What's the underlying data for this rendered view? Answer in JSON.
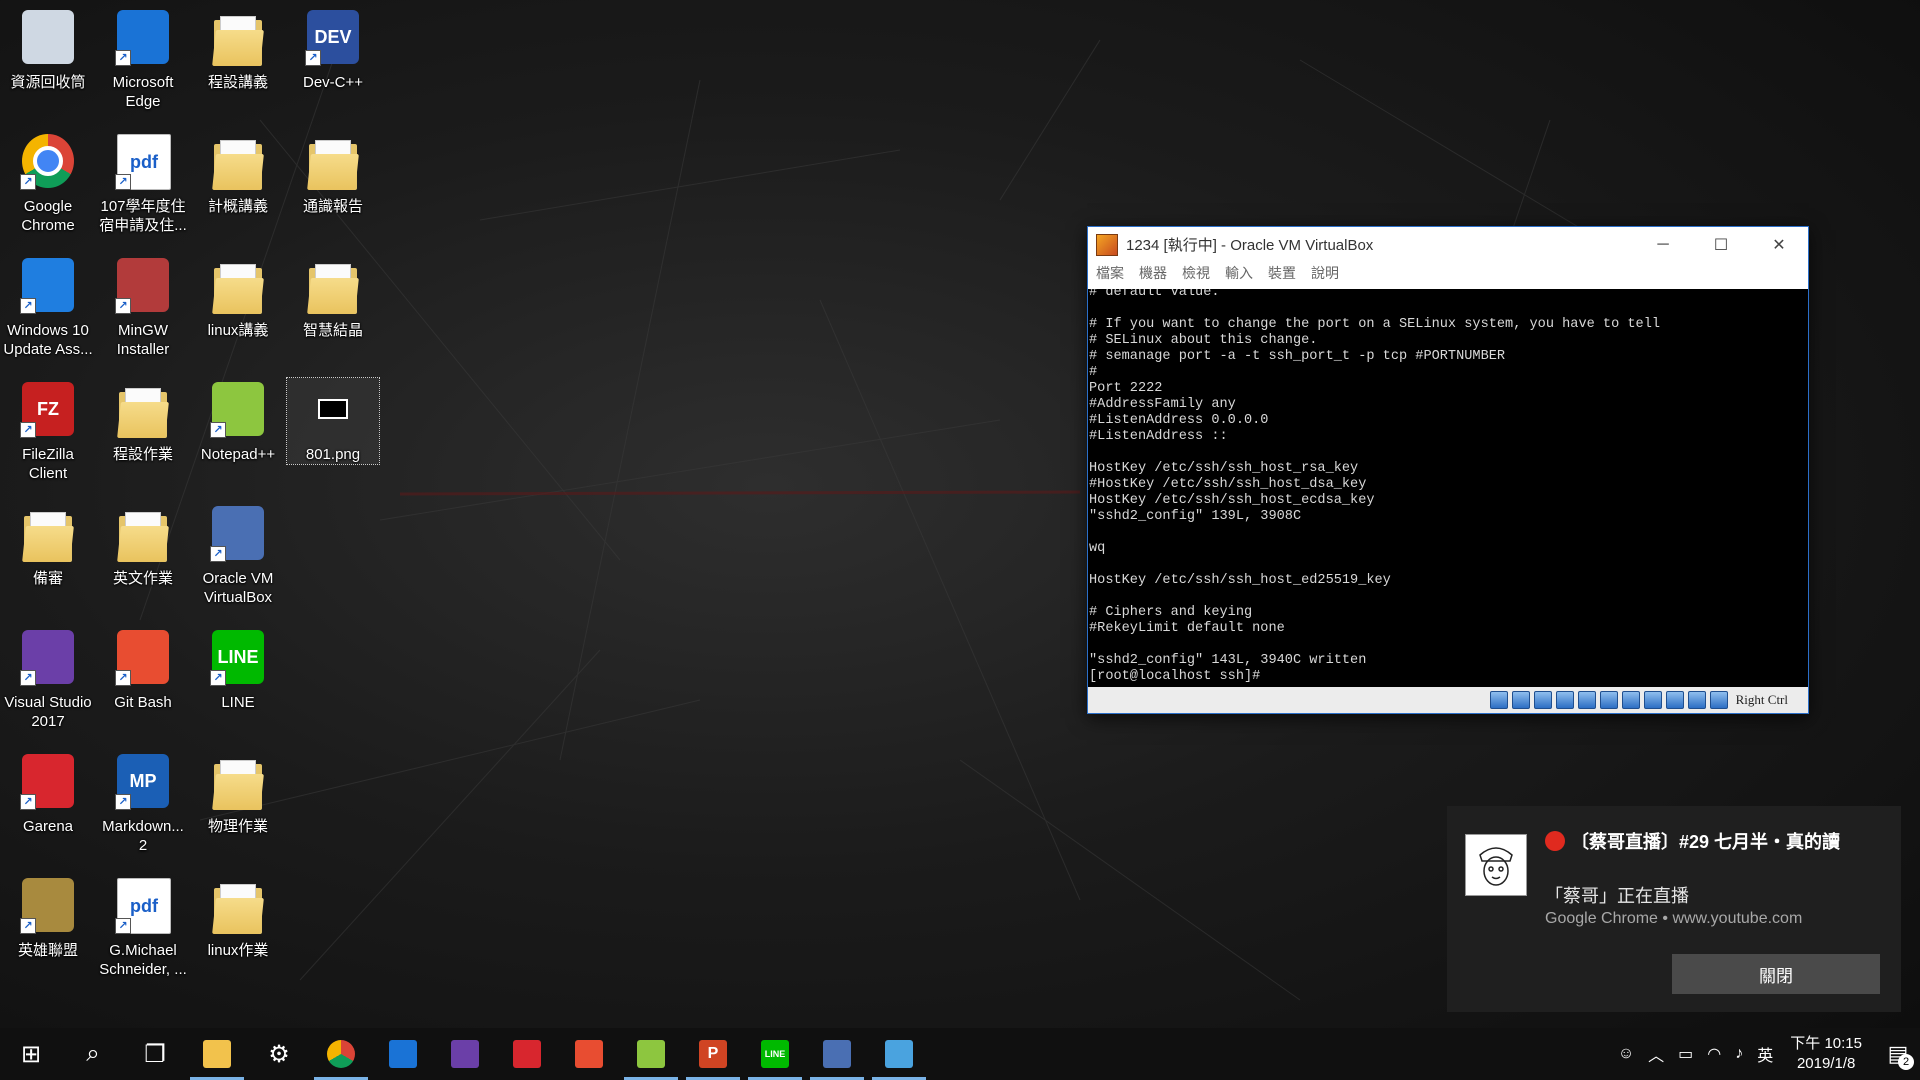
{
  "desktop": {
    "icons": [
      {
        "label": "資源回收筒",
        "icon": "recycle-bin-icon"
      },
      {
        "label": "Microsoft Edge",
        "icon": "edge-icon"
      },
      {
        "label": "程設講義",
        "icon": "folder-icon"
      },
      {
        "label": "Dev-C++",
        "icon": "devcpp-icon",
        "glyph": "DEV"
      },
      {
        "label": "Google Chrome",
        "icon": "chrome-icon"
      },
      {
        "label": "107學年度住宿申請及住...",
        "icon": "pdf-icon",
        "glyph": "pdf"
      },
      {
        "label": "計概講義",
        "icon": "folder-icon"
      },
      {
        "label": "通識報告",
        "icon": "folder-icon"
      },
      {
        "label": "Windows 10 Update Ass...",
        "icon": "windows-update-icon"
      },
      {
        "label": "MinGW Installer",
        "icon": "mingw-icon"
      },
      {
        "label": "linux講義",
        "icon": "folder-icon"
      },
      {
        "label": "智慧結晶",
        "icon": "folder-icon"
      },
      {
        "label": "FileZilla Client",
        "icon": "filezilla-icon",
        "glyph": "FZ"
      },
      {
        "label": "程設作業",
        "icon": "folder-icon"
      },
      {
        "label": "Notepad++",
        "icon": "notepadpp-icon"
      },
      {
        "label": "801.png",
        "icon": "image-file-icon"
      },
      {
        "label": "備審",
        "icon": "folder-icon"
      },
      {
        "label": "英文作業",
        "icon": "folder-icon"
      },
      {
        "label": "Oracle VM VirtualBox",
        "icon": "virtualbox-icon"
      },
      {
        "label": "Visual Studio 2017",
        "icon": "visual-studio-icon"
      },
      {
        "label": "Git Bash",
        "icon": "git-icon"
      },
      {
        "label": "LINE",
        "icon": "line-icon",
        "glyph": "LINE"
      },
      {
        "label": "Garena",
        "icon": "garena-icon"
      },
      {
        "label": "Markdown... 2",
        "icon": "markdown-icon",
        "glyph": "MP"
      },
      {
        "label": "物理作業",
        "icon": "folder-icon"
      },
      {
        "label": "英雄聯盟",
        "icon": "lol-icon"
      },
      {
        "label": "G.Michael Schneider, ...",
        "icon": "pdf-icon",
        "glyph": "pdf"
      },
      {
        "label": "linux作業",
        "icon": "folder-icon"
      }
    ]
  },
  "vbox": {
    "title": "1234 [執行中] - Oracle VM VirtualBox",
    "minimize": "─",
    "maximize": "☐",
    "close": "✕",
    "menu": [
      "檔案",
      "機器",
      "檢視",
      "輸入",
      "裝置",
      "說明"
    ],
    "terminal": "# default value.\n\n# If you want to change the port on a SELinux system, you have to tell\n# SELinux about this change.\n# semanage port -a -t ssh_port_t -p tcp #PORTNUMBER\n#\nPort 2222\n#AddressFamily any\n#ListenAddress 0.0.0.0\n#ListenAddress ::\n\nHostKey /etc/ssh/ssh_host_rsa_key\n#HostKey /etc/ssh/ssh_host_dsa_key\nHostKey /etc/ssh/ssh_host_ecdsa_key\n\"sshd2_config\" 139L, 3908C\n\nwq\n\nHostKey /etc/ssh/ssh_host_ed25519_key\n\n# Ciphers and keying\n#RekeyLimit default none\n\n\"sshd2_config\" 143L, 3940C written\n[root@localhost ssh]#",
    "host_key": "Right Ctrl"
  },
  "toast": {
    "title": "〔蔡哥直播〕#29 七月半・真的讀",
    "body": "「蔡哥」正在直播",
    "source": "Google Chrome • www.youtube.com",
    "button": "關閉"
  },
  "taskbar": {
    "apps": [
      {
        "name": "start",
        "icon": "windows-start-icon"
      },
      {
        "name": "search",
        "icon": "search-icon"
      },
      {
        "name": "task-view",
        "icon": "task-view-icon"
      },
      {
        "name": "file-explorer",
        "icon": "file-explorer-icon"
      },
      {
        "name": "settings",
        "icon": "gear-icon"
      },
      {
        "name": "chrome",
        "icon": "chrome-icon"
      },
      {
        "name": "edge",
        "icon": "edge-icon"
      },
      {
        "name": "visual-studio",
        "icon": "visual-studio-icon"
      },
      {
        "name": "garena",
        "icon": "garena-icon"
      },
      {
        "name": "git",
        "icon": "git-icon"
      },
      {
        "name": "notepadpp",
        "icon": "notepadpp-icon"
      },
      {
        "name": "powerpoint",
        "icon": "powerpoint-icon",
        "glyph": "P"
      },
      {
        "name": "line",
        "icon": "line-icon",
        "glyph": "LINE"
      },
      {
        "name": "virtualbox",
        "icon": "virtualbox-icon"
      },
      {
        "name": "paint",
        "icon": "paint-icon"
      }
    ],
    "ime": "英",
    "time": "下午 10:15",
    "date": "2019/1/8",
    "notification_count": "2"
  }
}
